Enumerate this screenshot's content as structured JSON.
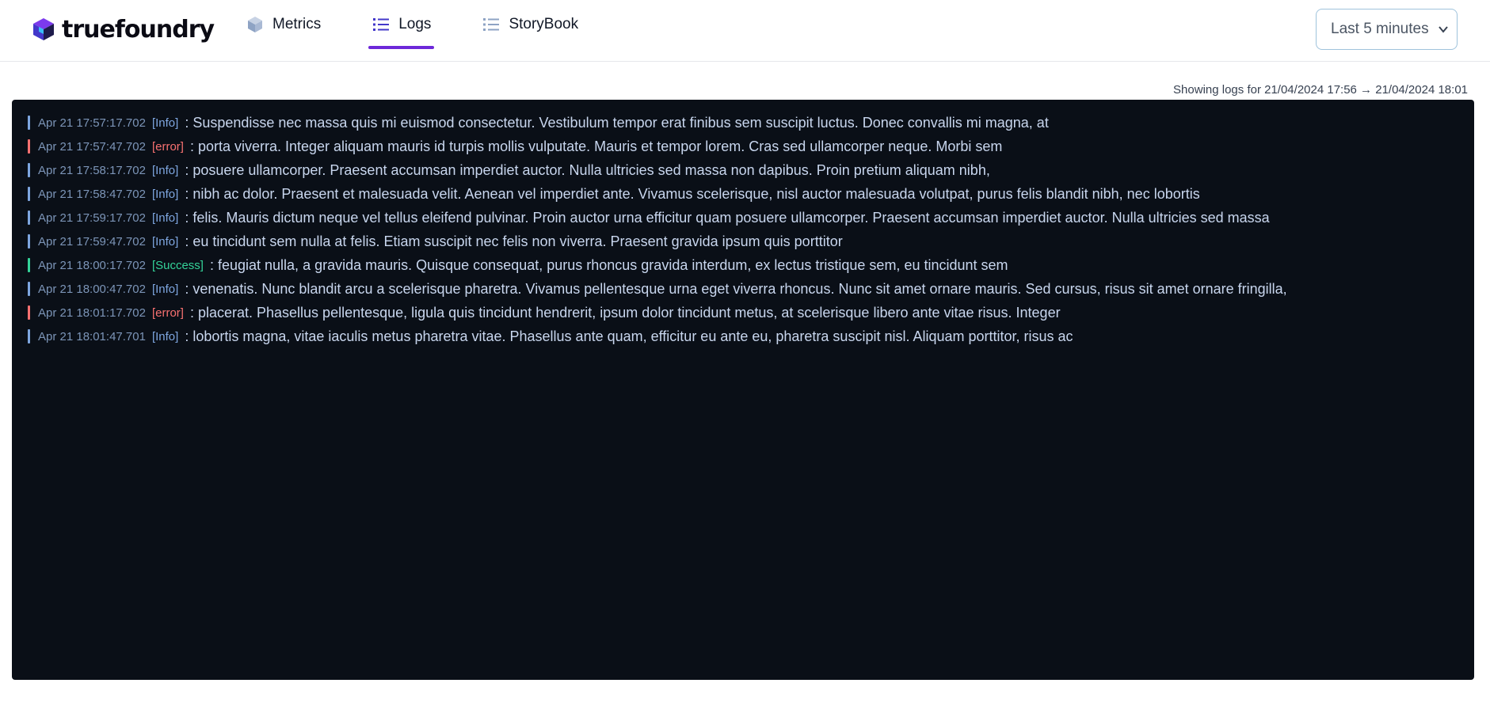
{
  "brand": {
    "name": "truefoundry"
  },
  "nav": {
    "tabs": [
      {
        "label": "Metrics",
        "icon": "cube-icon",
        "active": false
      },
      {
        "label": "Logs",
        "icon": "list-icon",
        "active": true
      },
      {
        "label": "StoryBook",
        "icon": "list-icon",
        "active": false
      }
    ]
  },
  "time_range": {
    "selected": "Last 5 minutes"
  },
  "range_text": "Showing logs for 21/04/2024 17:56 → 21/04/2024 18:01",
  "colors": {
    "info": "#7ea6e0",
    "error": "#f87171",
    "success": "#34d399",
    "accent": "#6d28d9"
  },
  "logs": [
    {
      "time": "Apr 21 17:57:17.702",
      "level": "[Info]",
      "type": "info",
      "message": ": Suspendisse nec massa quis mi euismod consectetur. Vestibulum tempor erat finibus sem suscipit luctus. Donec convallis mi magna, at"
    },
    {
      "time": "Apr 21 17:57:47.702",
      "level": "[error]",
      "type": "error",
      "message": ": porta viverra. Integer aliquam mauris id turpis mollis vulputate. Mauris et tempor lorem. Cras sed ullamcorper neque. Morbi sem"
    },
    {
      "time": "Apr 21 17:58:17.702",
      "level": "[Info]",
      "type": "info",
      "message": ": posuere ullamcorper. Praesent accumsan imperdiet auctor. Nulla ultricies sed massa non dapibus. Proin pretium aliquam nibh,"
    },
    {
      "time": "Apr 21 17:58:47.702",
      "level": "[Info]",
      "type": "info",
      "message": ": nibh ac dolor. Praesent et malesuada velit. Aenean vel imperdiet ante. Vivamus scelerisque, nisl auctor malesuada volutpat, purus felis blandit nibh, nec lobortis"
    },
    {
      "time": "Apr 21 17:59:17.702",
      "level": "[Info]",
      "type": "info",
      "message": ": felis. Mauris dictum neque vel tellus eleifend pulvinar. Proin auctor urna efficitur quam posuere ullamcorper. Praesent accumsan imperdiet auctor. Nulla ultricies sed massa"
    },
    {
      "time": "Apr 21 17:59:47.702",
      "level": "[Info]",
      "type": "info",
      "message": ": eu tincidunt sem nulla at felis. Etiam suscipit nec felis non viverra. Praesent gravida ipsum quis porttitor"
    },
    {
      "time": "Apr 21 18:00:17.702",
      "level": "[Success]",
      "type": "success",
      "message": ": feugiat nulla, a gravida mauris. Quisque consequat, purus rhoncus gravida interdum, ex lectus tristique sem, eu tincidunt sem"
    },
    {
      "time": "Apr 21 18:00:47.702",
      "level": "[Info]",
      "type": "info",
      "message": ": venenatis. Nunc blandit arcu a scelerisque pharetra. Vivamus pellentesque urna eget viverra rhoncus. Nunc sit amet ornare mauris. Sed cursus, risus sit amet ornare fringilla,"
    },
    {
      "time": "Apr 21 18:01:17.702",
      "level": "[error]",
      "type": "error",
      "message": ": placerat. Phasellus pellentesque, ligula quis tincidunt hendrerit, ipsum dolor tincidunt metus, at scelerisque libero ante vitae risus. Integer"
    },
    {
      "time": "Apr 21 18:01:47.701",
      "level": "[Info]",
      "type": "info",
      "message": ": lobortis magna, vitae iaculis metus pharetra vitae. Phasellus ante quam, efficitur eu ante eu, pharetra suscipit nisl. Aliquam porttitor, risus ac"
    }
  ]
}
